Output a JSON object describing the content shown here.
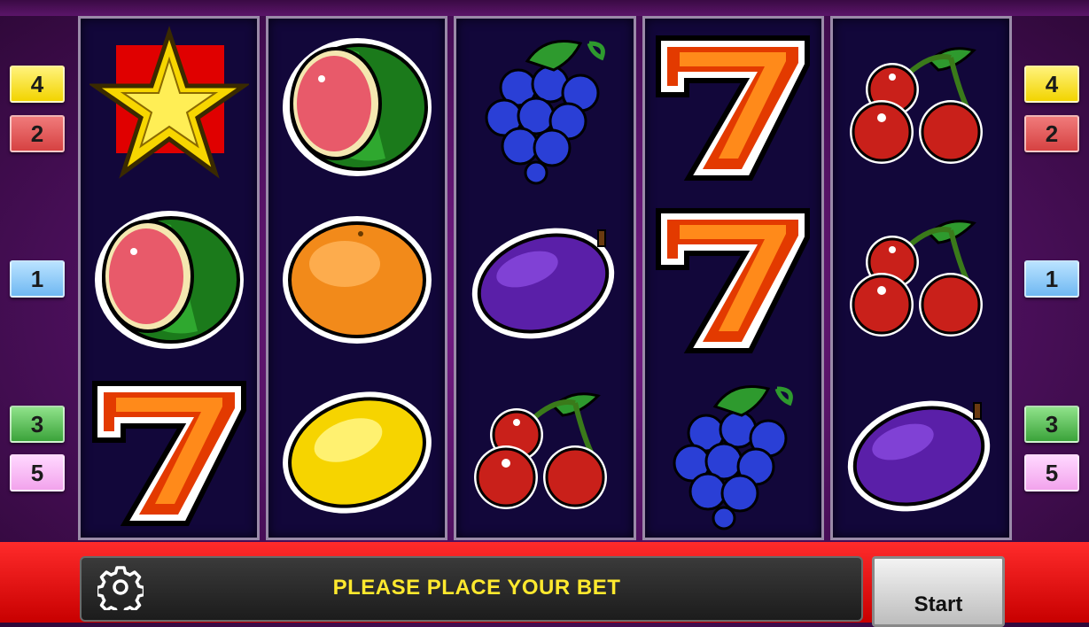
{
  "reels": [
    [
      "star",
      "watermelon",
      "seven"
    ],
    [
      "watermelon",
      "orange",
      "lemon"
    ],
    [
      "grapes",
      "plum",
      "cherries"
    ],
    [
      "seven",
      "seven",
      "grapes"
    ],
    [
      "cherries",
      "cherries",
      "plum"
    ]
  ],
  "paylines_left": [
    "4",
    "2",
    "1",
    "3",
    "5"
  ],
  "paylines_right": [
    "4",
    "2",
    "1",
    "3",
    "5"
  ],
  "paylines_colors": {
    "4": "#f2d400",
    "2": "#d64242",
    "1": "#6fb8f2",
    "3": "#3ba33a",
    "5": "#f2a3ec"
  },
  "message": "PLEASE PLACE YOUR BET",
  "start_label": "Start",
  "settings_icon": "gear-icon"
}
